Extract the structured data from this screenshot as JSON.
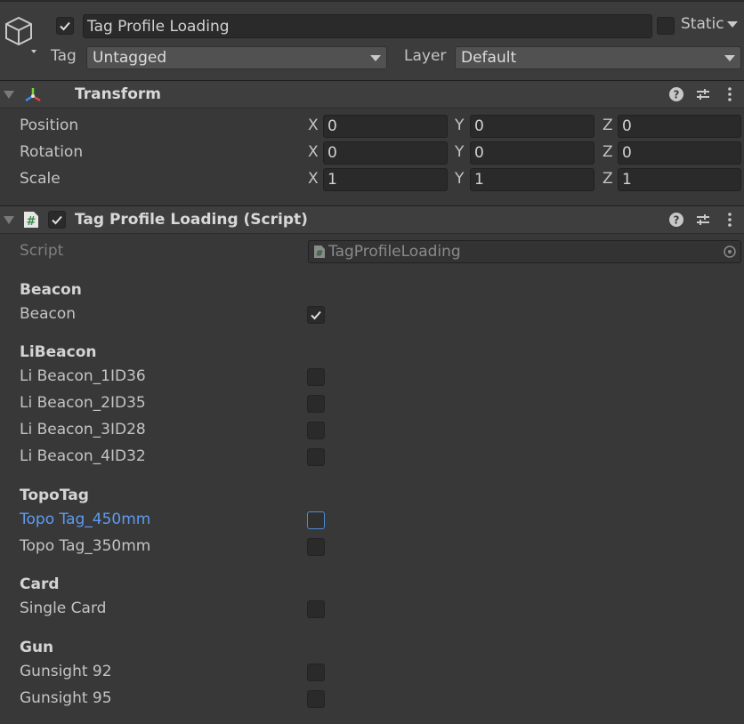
{
  "header": {
    "active": true,
    "name": "Tag Profile Loading",
    "static_label": "Static",
    "static_checked": false,
    "tag_label": "Tag",
    "tag_value": "Untagged",
    "layer_label": "Layer",
    "layer_value": "Default"
  },
  "transform": {
    "title": "Transform",
    "rows": [
      {
        "label": "Position",
        "x": "0",
        "y": "0",
        "z": "0"
      },
      {
        "label": "Rotation",
        "x": "0",
        "y": "0",
        "z": "0"
      },
      {
        "label": "Scale",
        "x": "1",
        "y": "1",
        "z": "1"
      }
    ],
    "axis_labels": {
      "x": "X",
      "y": "Y",
      "z": "Z"
    }
  },
  "component": {
    "title": "Tag Profile Loading (Script)",
    "enabled": true,
    "script_label": "Script",
    "script_value": "TagProfileLoading",
    "groups": [
      {
        "header": "Beacon",
        "items": [
          {
            "label": "Beacon",
            "checked": true
          }
        ]
      },
      {
        "header": "LiBeacon",
        "items": [
          {
            "label": "Li Beacon_1ID36",
            "checked": false
          },
          {
            "label": "Li Beacon_2ID35",
            "checked": false
          },
          {
            "label": "Li Beacon_3ID28",
            "checked": false
          },
          {
            "label": "Li Beacon_4ID32",
            "checked": false
          }
        ]
      },
      {
        "header": "TopoTag",
        "items": [
          {
            "label": "Topo Tag_450mm",
            "checked": false,
            "highlighted": true
          },
          {
            "label": "Topo Tag_350mm",
            "checked": false
          }
        ]
      },
      {
        "header": "Card",
        "items": [
          {
            "label": "Single Card",
            "checked": false
          }
        ]
      },
      {
        "header": "Gun",
        "items": [
          {
            "label": "Gunsight 92",
            "checked": false
          },
          {
            "label": "Gunsight 95",
            "checked": false
          }
        ]
      }
    ]
  },
  "colors": {
    "background": "#383838",
    "accent": "#5d9bf0",
    "text": "#c4c4c4"
  },
  "icons": [
    "gameobject-cube-icon",
    "transform-axes-icon",
    "script-hash-icon",
    "help-icon",
    "presets-icon",
    "more-options-icon",
    "object-picker-icon"
  ]
}
